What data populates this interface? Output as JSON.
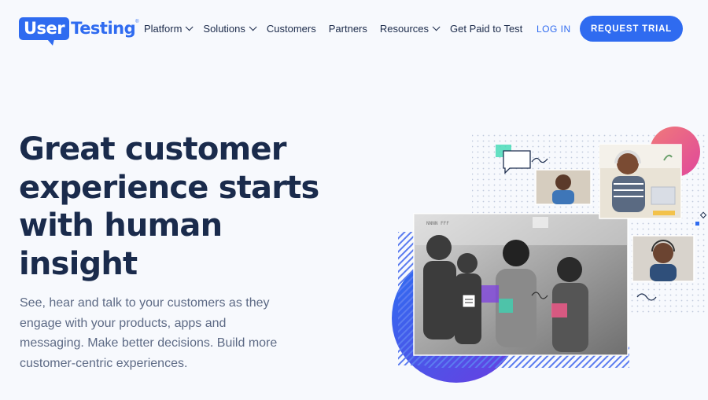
{
  "brand": {
    "logo_box": "User",
    "logo_text": "Testing",
    "logo_reg": "®"
  },
  "nav": {
    "items": [
      {
        "label": "Platform",
        "has_dropdown": true
      },
      {
        "label": "Solutions",
        "has_dropdown": true
      },
      {
        "label": "Customers",
        "has_dropdown": false
      },
      {
        "label": "Partners",
        "has_dropdown": false
      },
      {
        "label": "Resources",
        "has_dropdown": true
      },
      {
        "label": "Get Paid to Test",
        "has_dropdown": false
      }
    ],
    "login_label": "LOG IN",
    "trial_label": "REQUEST TRIAL"
  },
  "hero": {
    "title": "Great customer experience starts with human insight",
    "subtitle": "See, hear and talk to your customers as they engage with your products, apps and messaging. Make better decisions. Build more customer-centric experiences."
  },
  "colors": {
    "brand_blue": "#2f6bf0",
    "heading": "#1a2b4c",
    "body_text": "#5d6a85",
    "background": "#f7f9fd"
  }
}
